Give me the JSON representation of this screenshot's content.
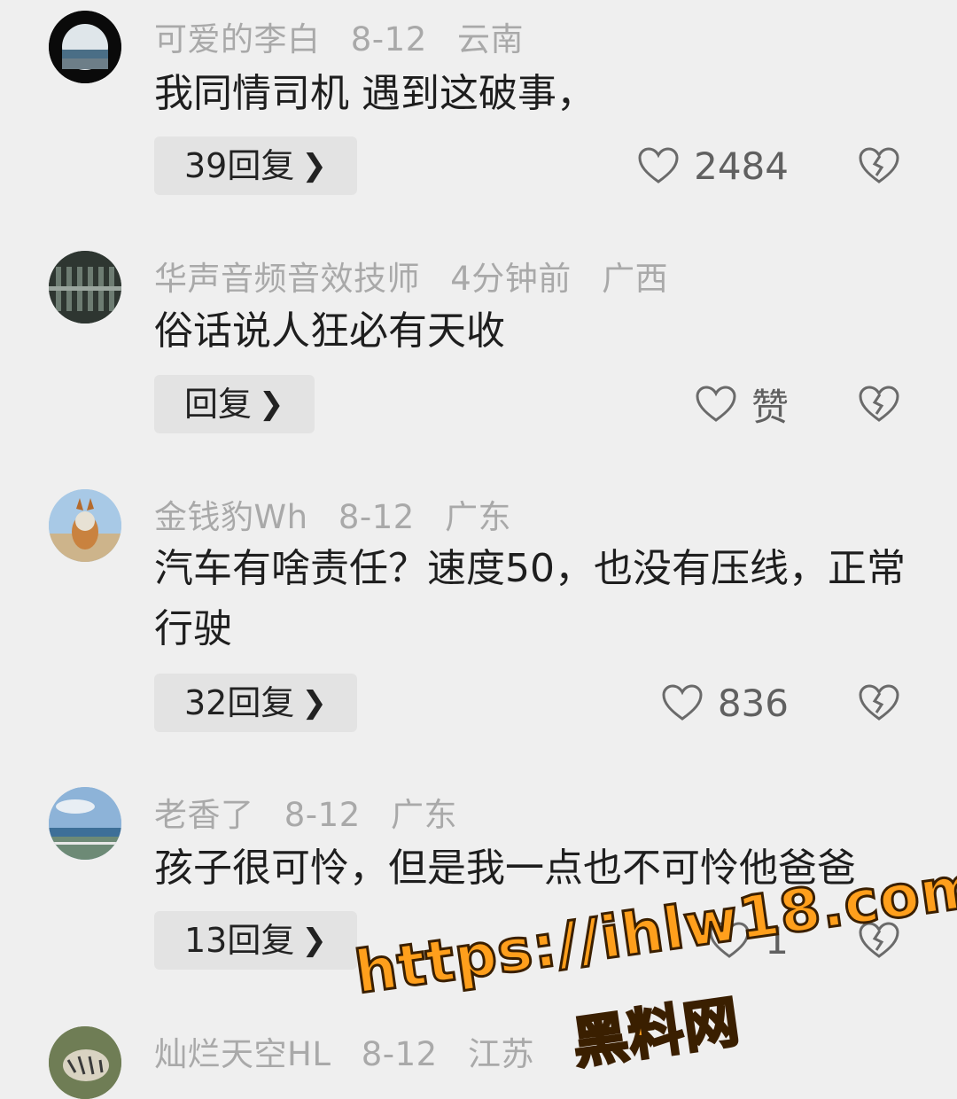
{
  "comments": [
    {
      "username": "可爱的李白",
      "date": "8-12",
      "location": "云南",
      "text": "我同情司机 遇到这破事，",
      "reply_label": "39回复",
      "likes": "2484"
    },
    {
      "username": "华声音频音效技师",
      "date": "4分钟前",
      "location": "广西",
      "text": "俗话说人狂必有天收",
      "reply_label": "回复",
      "likes": "赞"
    },
    {
      "username": "金钱豹Wh",
      "date": "8-12",
      "location": "广东",
      "text": "汽车有啥责任？速度50，也没有压线，正常行驶",
      "reply_label": "32回复",
      "likes": "836"
    },
    {
      "username": "老香了",
      "date": "8-12",
      "location": "广东",
      "text": "孩子很可怜，但是我一点也不可怜他爸爸",
      "reply_label": "13回复",
      "likes": "1"
    },
    {
      "username": "灿烂天空HL",
      "date": "8-12",
      "location": "江苏"
    }
  ],
  "watermark": {
    "url": "https://ihlw18.com",
    "name": "黑料网"
  },
  "icons": {
    "like": "heart-outline-icon",
    "dislike": "broken-heart-icon",
    "chevron": "chevron-right-icon"
  },
  "colors": {
    "background": "#efefef",
    "meta_text": "#a9a9a9",
    "reply_button_bg": "#e3e3e3",
    "watermark_fill": "#ff9f1c"
  }
}
